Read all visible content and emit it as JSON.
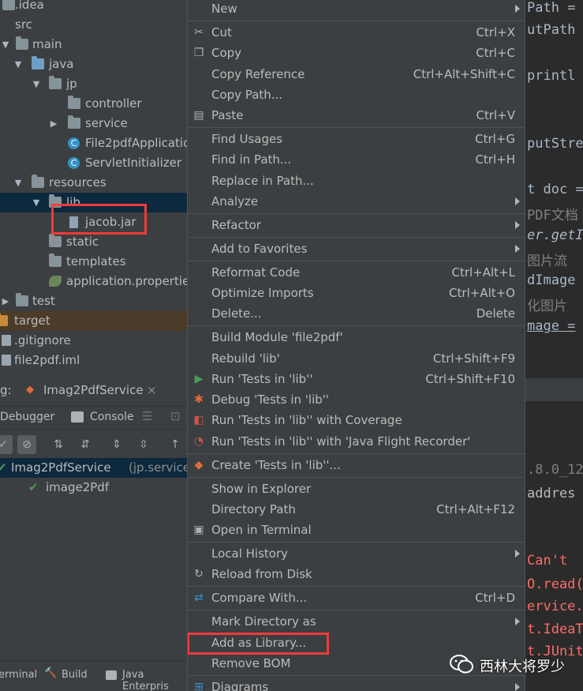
{
  "tree": {
    "items": [
      {
        "label": ".idea"
      },
      {
        "label": "src"
      },
      {
        "label": "main"
      },
      {
        "label": "java"
      },
      {
        "label": "jp"
      },
      {
        "label": "controller"
      },
      {
        "label": "service"
      },
      {
        "label": "File2pdfApplicatio"
      },
      {
        "label": "ServletInitializer"
      },
      {
        "label": "resources"
      },
      {
        "label": "lib"
      },
      {
        "label": "jacob.jar"
      },
      {
        "label": "static"
      },
      {
        "label": "templates"
      },
      {
        "label": "application.propertie"
      },
      {
        "label": "test"
      },
      {
        "label": "target"
      },
      {
        "label": ".gitignore"
      },
      {
        "label": "file2pdf.iml"
      }
    ]
  },
  "run": {
    "prefix": "g:",
    "config_name": "Imag2PdfService",
    "tabs": {
      "debugger": "Debugger",
      "console": "Console"
    },
    "tests": {
      "root_label": "Imag2PdfService",
      "root_pkg": "(jp.service",
      "child_label": "image2Pdf"
    }
  },
  "bottom_tabs": {
    "terminal": "erminal",
    "build": "Build",
    "java_ent": "Java Enterpris"
  },
  "menu": {
    "items": [
      {
        "label": "New",
        "key": "",
        "submenu": true
      },
      {
        "label": "Cut",
        "key": "Ctrl+X"
      },
      {
        "label": "Copy",
        "key": "Ctrl+C"
      },
      {
        "label": "Copy Reference",
        "key": "Ctrl+Alt+Shift+C"
      },
      {
        "label": "Copy Path...",
        "key": ""
      },
      {
        "label": "Paste",
        "key": "Ctrl+V"
      },
      {
        "label": "Find Usages",
        "key": "Ctrl+G"
      },
      {
        "label": "Find in Path...",
        "key": "Ctrl+H"
      },
      {
        "label": "Replace in Path...",
        "key": ""
      },
      {
        "label": "Analyze",
        "key": "",
        "submenu": true
      },
      {
        "label": "Refactor",
        "key": "",
        "submenu": true
      },
      {
        "label": "Add to Favorites",
        "key": "",
        "submenu": true
      },
      {
        "label": "Reformat Code",
        "key": "Ctrl+Alt+L"
      },
      {
        "label": "Optimize Imports",
        "key": "Ctrl+Alt+O"
      },
      {
        "label": "Delete...",
        "key": "Delete"
      },
      {
        "label": "Build Module 'file2pdf'",
        "key": ""
      },
      {
        "label": "Rebuild 'lib'",
        "key": "Ctrl+Shift+F9"
      },
      {
        "label": "Run 'Tests in 'lib''",
        "key": "Ctrl+Shift+F10"
      },
      {
        "label": "Debug 'Tests in 'lib''",
        "key": ""
      },
      {
        "label": "Run 'Tests in 'lib'' with Coverage",
        "key": ""
      },
      {
        "label": "Run 'Tests in 'lib'' with 'Java Flight Recorder'",
        "key": ""
      },
      {
        "label": "Create 'Tests in 'lib''...",
        "key": ""
      },
      {
        "label": "Show in Explorer",
        "key": ""
      },
      {
        "label": "Directory Path",
        "key": "Ctrl+Alt+F12"
      },
      {
        "label": "Open in Terminal",
        "key": ""
      },
      {
        "label": "Local History",
        "key": "",
        "submenu": true
      },
      {
        "label": "Reload from Disk",
        "key": ""
      },
      {
        "label": "Compare With...",
        "key": "Ctrl+D"
      },
      {
        "label": "Mark Directory as",
        "key": "",
        "submenu": true
      },
      {
        "label": "Add as Library...",
        "key": ""
      },
      {
        "label": "Remove BOM",
        "key": ""
      },
      {
        "label": "Diagrams",
        "key": "",
        "submenu": true
      }
    ]
  },
  "editor": {
    "lines": [
      "Path =",
      "utPath",
      "printl",
      "putStre",
      "t doc =",
      "PDF文档",
      "er.getI",
      "图片流",
      "dImage",
      "化图片",
      "mage ="
    ]
  },
  "console": {
    "lines": [
      ".8.0_12",
      " addres",
      "Can't",
      "O.read(",
      "ervice.",
      "t.IdeaT",
      "t.JUnit"
    ]
  },
  "watermark": {
    "text": "西林大将罗少"
  },
  "colors": {
    "accent_red": "#ef3b3b",
    "selection": "#0d293e",
    "check_green": "#499c54"
  }
}
